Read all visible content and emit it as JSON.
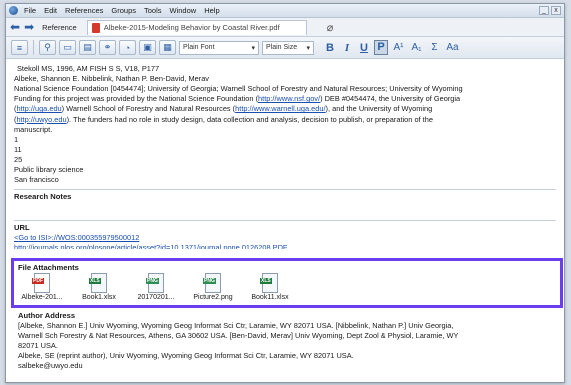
{
  "menubar": {
    "items": [
      "File",
      "Edit",
      "References",
      "Groups",
      "Tools",
      "Window",
      "Help"
    ],
    "win_minimize": "_",
    "win_close": "x"
  },
  "tabbar": {
    "reference_label": "Reference",
    "doc_tab_label": "Albeke-2015-Modeling Behavior by Coastal River.pdf"
  },
  "toolbar": {
    "font_select": "Plain Font",
    "size_select": "Plain Size",
    "bold": "B",
    "italic": "I",
    "underline": "U",
    "plain": "P",
    "superscript": "A¹",
    "subscript": "A₁",
    "symbol": "Σ",
    "case": "Aa"
  },
  "record": {
    "cited_line": "Stekoll MS, 1996, AM FISH S S, V18, P177",
    "authors_line": "Albeke, Shannon E. Nibbelink, Nathan P. Ben-David, Merav",
    "funding_1": "National Science Foundation [0454474]; University of Georgia; Warnell School of Forestry and Natural Resources; University of Wyoming",
    "funding_2a": "Funding for this project was provided by the National Science Foundation (",
    "funding_link1": "http://www.nsf.gov/",
    "funding_2b": ") DEB #0454474, the University of Georgia",
    "funding_link2": "http://uga.edu",
    "funding_3a": ") Warnell School of Forestry and Natural Resources (",
    "funding_link3": "http://www.warnell.uga.edu/",
    "funding_3b": "), and the University of Wyoming",
    "funding_link4": "http://uwyo.edu",
    "funding_4b": "). The funders had no role in study design, data collection and analysis, decision to publish, or preparation of the",
    "funding_5": "manuscript.",
    "val_1": "1",
    "val_2": "11",
    "val_3": "25",
    "val_4": "Public library science",
    "val_5": "San francisco",
    "research_notes_label": "Research Notes",
    "url_label": "URL",
    "url_link1": "<Go to ISI>://WOS:000355979500012",
    "url_link2": "http://journals.plos.org/plosone/article/asset?id=10.1371/journal.pone.0126208.PDF"
  },
  "attachments": {
    "title": "File Attachments",
    "files": [
      {
        "name": "Albeke-201...",
        "type": "PDF"
      },
      {
        "name": "Book1.xlsx",
        "type": "XLS"
      },
      {
        "name": "20170201...",
        "type": "PNG"
      },
      {
        "name": "Picture2.png",
        "type": "PNG"
      },
      {
        "name": "Book11.xlsx",
        "type": "XLS"
      }
    ]
  },
  "author_address": {
    "title": "Author Address",
    "line1": "[Albeke, Shannon E.] Univ Wyoming, Wyoming Geog Informat Sci Ctr, Laramie, WY 82071 USA. [Nibbelink, Nathan P.] Univ Georgia,",
    "line2": "Warnell Sch Forestry & Nat Resources, Athens, GA 30602 USA. [Ben-David, Merav] Univ Wyoming, Dept Zool & Physiol, Laramie, WY",
    "line3": "82071 USA.",
    "line4": "Albeke, SE (reprint author), Univ Wyoming, Wyoming Geog Informat Sci Ctr, Laramie, WY 82071 USA.",
    "line5": "salbeke@uwyo.edu"
  },
  "colors": {
    "highlight_border": "#6a3df0",
    "link": "#1a4fb0",
    "pdf_red": "#c62d22",
    "excel_green": "#1f7a3e"
  }
}
